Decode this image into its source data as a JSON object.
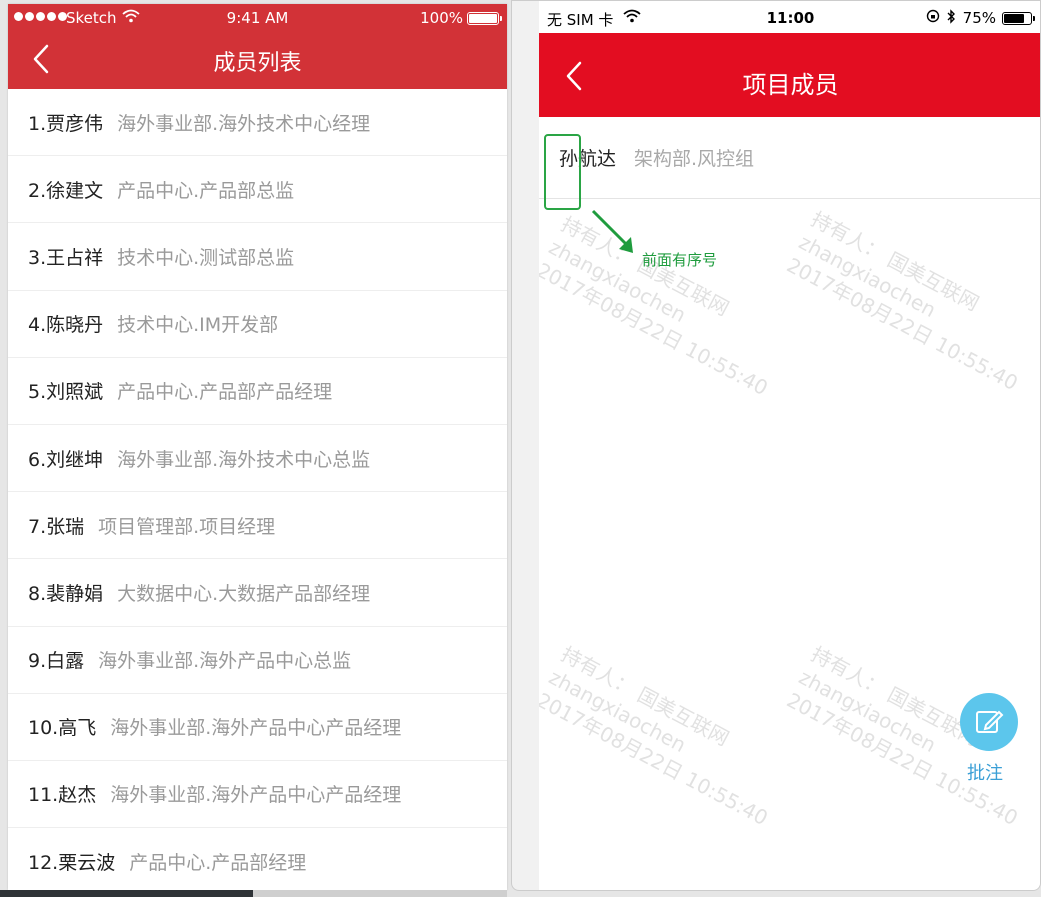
{
  "left": {
    "status": {
      "carrier": "Sketch",
      "time": "9:41 AM",
      "battery": "100%"
    },
    "nav": {
      "title": "成员列表",
      "back_icon": "chevron-left-icon"
    },
    "members": [
      {
        "name": "1.贾彦伟",
        "dept": "海外事业部.海外技术中心经理"
      },
      {
        "name": "2.徐建文",
        "dept": "产品中心.产品部总监"
      },
      {
        "name": "3.王占祥",
        "dept": "技术中心.测试部总监"
      },
      {
        "name": "4.陈晓丹",
        "dept": "技术中心.IM开发部"
      },
      {
        "name": "5.刘照斌",
        "dept": "产品中心.产品部产品经理"
      },
      {
        "name": "6.刘继坤",
        "dept": "海外事业部.海外技术中心总监"
      },
      {
        "name": "7.张瑞",
        "dept": "项目管理部.项目经理"
      },
      {
        "name": "8.裴静娟",
        "dept": "大数据中心.大数据产品部经理"
      },
      {
        "name": "9.白露",
        "dept": "海外事业部.海外产品中心总监"
      },
      {
        "name": "10.高飞",
        "dept": "海外事业部.海外产品中心产品经理"
      },
      {
        "name": "11.赵杰",
        "dept": "海外事业部.海外产品中心产品经理"
      },
      {
        "name": "12.栗云波",
        "dept": "产品中心.产品部经理"
      }
    ]
  },
  "right": {
    "status": {
      "carrier": "无 SIM 卡",
      "time": "11:00",
      "battery": "75%"
    },
    "nav": {
      "title": "项目成员",
      "back_icon": "chevron-left-icon"
    },
    "member": {
      "name": "孙航达",
      "dept": "架构部.风控组"
    },
    "annotation": {
      "text": "前面有序号",
      "color": "#1f9c3e"
    },
    "watermark": {
      "line1": "持有人：  国美互联网",
      "line2": "zhangxiaochen",
      "line3": "2017年08月22日 10:55:40"
    },
    "fab": {
      "label": "批注",
      "icon": "edit-icon"
    }
  },
  "colors": {
    "left_accent": "#d23237",
    "right_accent": "#e30d21",
    "fab": "#5cc6ec"
  }
}
